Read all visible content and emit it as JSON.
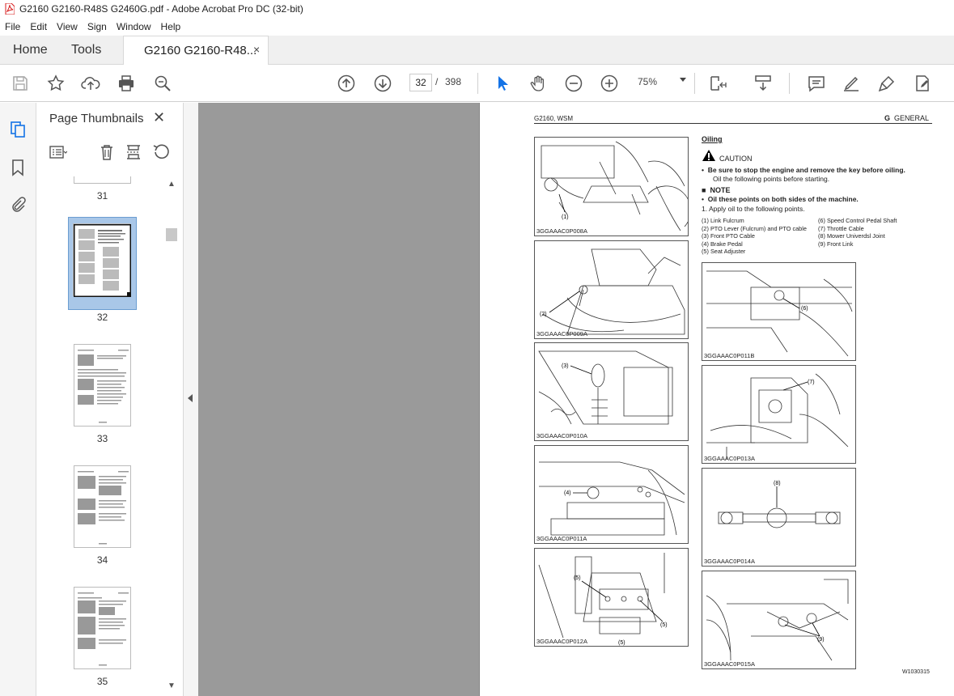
{
  "window": {
    "title": "G2160 G2160-R48S G2460G.pdf - Adobe Acrobat Pro DC (32-bit)"
  },
  "menu": [
    "File",
    "Edit",
    "View",
    "Sign",
    "Window",
    "Help"
  ],
  "tabs": {
    "home": "Home",
    "tools": "Tools",
    "document": "G2160 G2160-R48...",
    "close": "×"
  },
  "toolbar": {
    "page_current": "32",
    "page_sep": "/",
    "page_total": "398",
    "zoom": "75%"
  },
  "thumbnails": {
    "title": "Page Thumbnails",
    "close": "✕",
    "pages": [
      "31",
      "32",
      "33",
      "34",
      "35"
    ],
    "selected": "32"
  },
  "document_page": {
    "header_left": "G2160, WSM",
    "header_right_letter": "G",
    "header_right": "GENERAL",
    "section_title": "Oiling",
    "caution_label": "CAUTION",
    "caution_bullet": "Be sure to stop the engine and remove the key before oiling.",
    "caution_text": "Oil the following points before starting.",
    "note_label": "NOTE",
    "note_bullet": "Oil these points on both sides of the machine.",
    "step1": "1.  Apply  oil to the following points.",
    "parts_left": [
      "(1)  Link Fulcrum",
      "(2)  PTO Lever (Fulcrum) and PTO cable",
      "(3)  Front PTO Cable",
      "(4)  Brake Pedal",
      "(5)  Seat Adjuster"
    ],
    "parts_right": [
      "(6)  Speed Control Pedal Shaft",
      "(7)  Throttle Cable",
      "(8)  Mower Univerdsl Joint",
      "(9)  Front Link"
    ],
    "figures_left": [
      {
        "caption": "3GGAAAC0P008A",
        "callouts": [
          "(1)"
        ]
      },
      {
        "caption": "3GGAAAC0P009A",
        "callouts": [
          "(2)"
        ]
      },
      {
        "caption": "3GGAAAC0P010A",
        "callouts": [
          "(3)"
        ]
      },
      {
        "caption": "3GGAAAC0P011A",
        "callouts": [
          "(4)"
        ]
      },
      {
        "caption": "3GGAAAC0P012A",
        "callouts": [
          "(5)",
          "(5)",
          "(5)"
        ]
      }
    ],
    "figures_right": [
      {
        "caption": "3GGAAAC0P011B",
        "callouts": [
          "(6)"
        ]
      },
      {
        "caption": "3GGAAAC0P013A",
        "callouts": [
          "(7)"
        ]
      },
      {
        "caption": "3GGAAAC0P014A",
        "callouts": [
          "(8)"
        ]
      },
      {
        "caption": "3GGAAAC0P015A",
        "callouts": [
          "(9)"
        ]
      }
    ],
    "footer_code": "W1030315"
  }
}
